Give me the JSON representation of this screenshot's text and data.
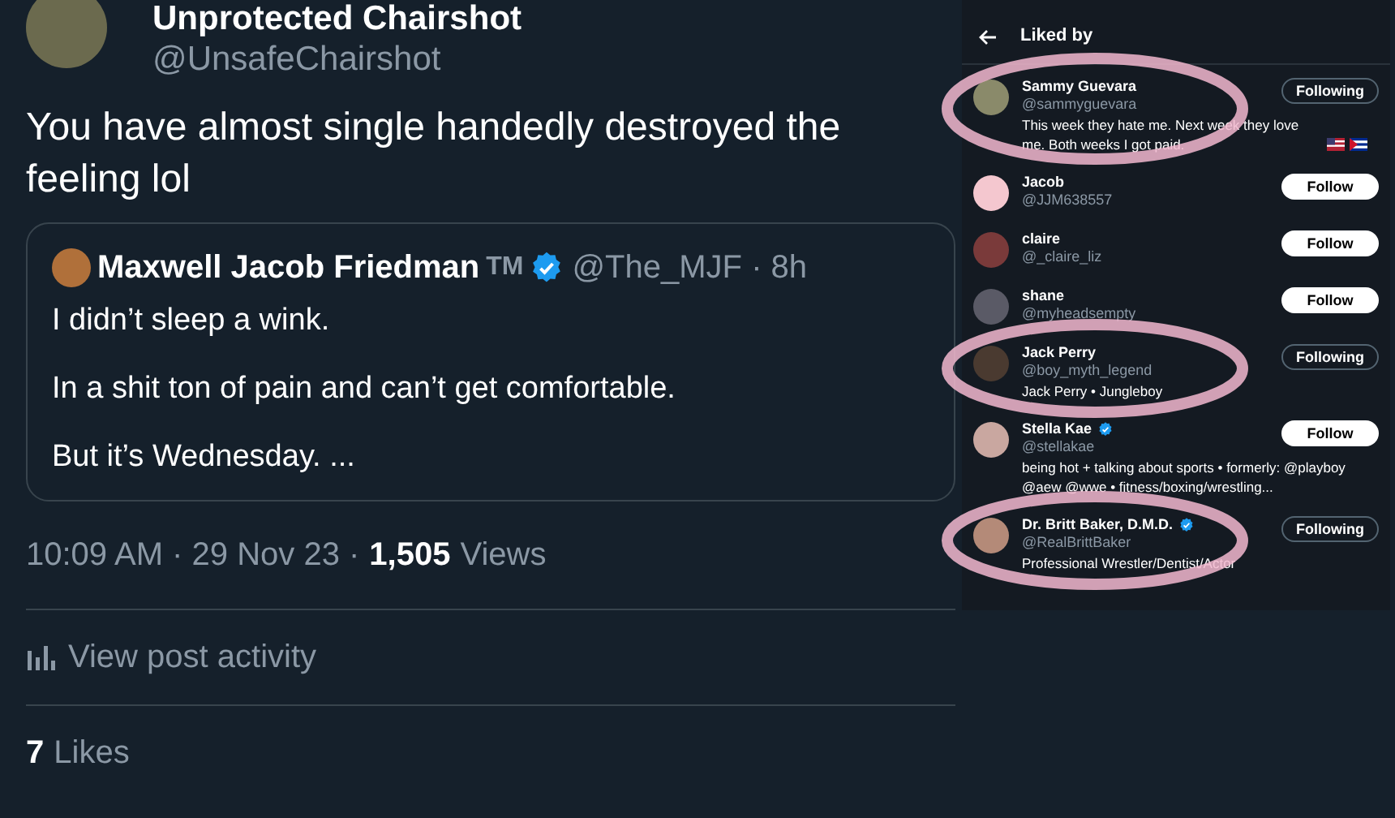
{
  "tweet": {
    "author": "Unprotected Chairshot",
    "handle": "@UnsafeChairshot",
    "text": "You have almost single handedly destroyed the feeling lol",
    "quote": {
      "author": "Maxwell Jacob Friedman",
      "tm": "TM",
      "verified": true,
      "handle": "@The_MJF",
      "time": "· 8h",
      "paragraphs": [
        "I didn’t sleep a wink.",
        "In a shit ton of pain and can’t get comfortable.",
        "But it’s Wednesday. ..."
      ]
    },
    "time": "10:09 AM · 29 Nov 23 ·",
    "views_count": "1,505",
    "views_label": "Views",
    "activity": "View post activity",
    "likes_count": "7",
    "likes_label": "Likes"
  },
  "liked_by": {
    "title": "Liked by",
    "users": [
      {
        "name": "Sammy Guevara",
        "handle": "@sammyguevara",
        "verified": false,
        "bio": "This week they hate me. Next week they love me. Both weeks I got paid.",
        "flags": true,
        "following": true,
        "button": "Following",
        "circled": true
      },
      {
        "name": "Jacob",
        "handle": "@JJM638557",
        "verified": false,
        "following": false,
        "button": "Follow",
        "circled": false
      },
      {
        "name": "claire",
        "handle": "@_claire_liz",
        "verified": false,
        "following": false,
        "button": "Follow",
        "circled": false
      },
      {
        "name": "shane",
        "handle": "@myheadsempty",
        "verified": false,
        "following": false,
        "button": "Follow",
        "circled": false
      },
      {
        "name": "Jack Perry",
        "handle": "@boy_myth_legend",
        "verified": false,
        "bio": "Jack Perry • Jungleboy",
        "following": true,
        "button": "Following",
        "circled": true
      },
      {
        "name": "Stella Kae",
        "handle": "@stellakae",
        "verified": true,
        "bio": "being hot + talking about sports • formerly: @playboy @aew @wwe • fitness/boxing/wrestling...",
        "following": false,
        "button": "Follow",
        "circled": false
      },
      {
        "name": "Dr. Britt Baker, D.M.D.",
        "handle": "@RealBrittBaker",
        "verified": true,
        "bio": "Professional Wrestler/Dentist/Actor",
        "following": true,
        "button": "Following",
        "circled": true
      }
    ]
  }
}
